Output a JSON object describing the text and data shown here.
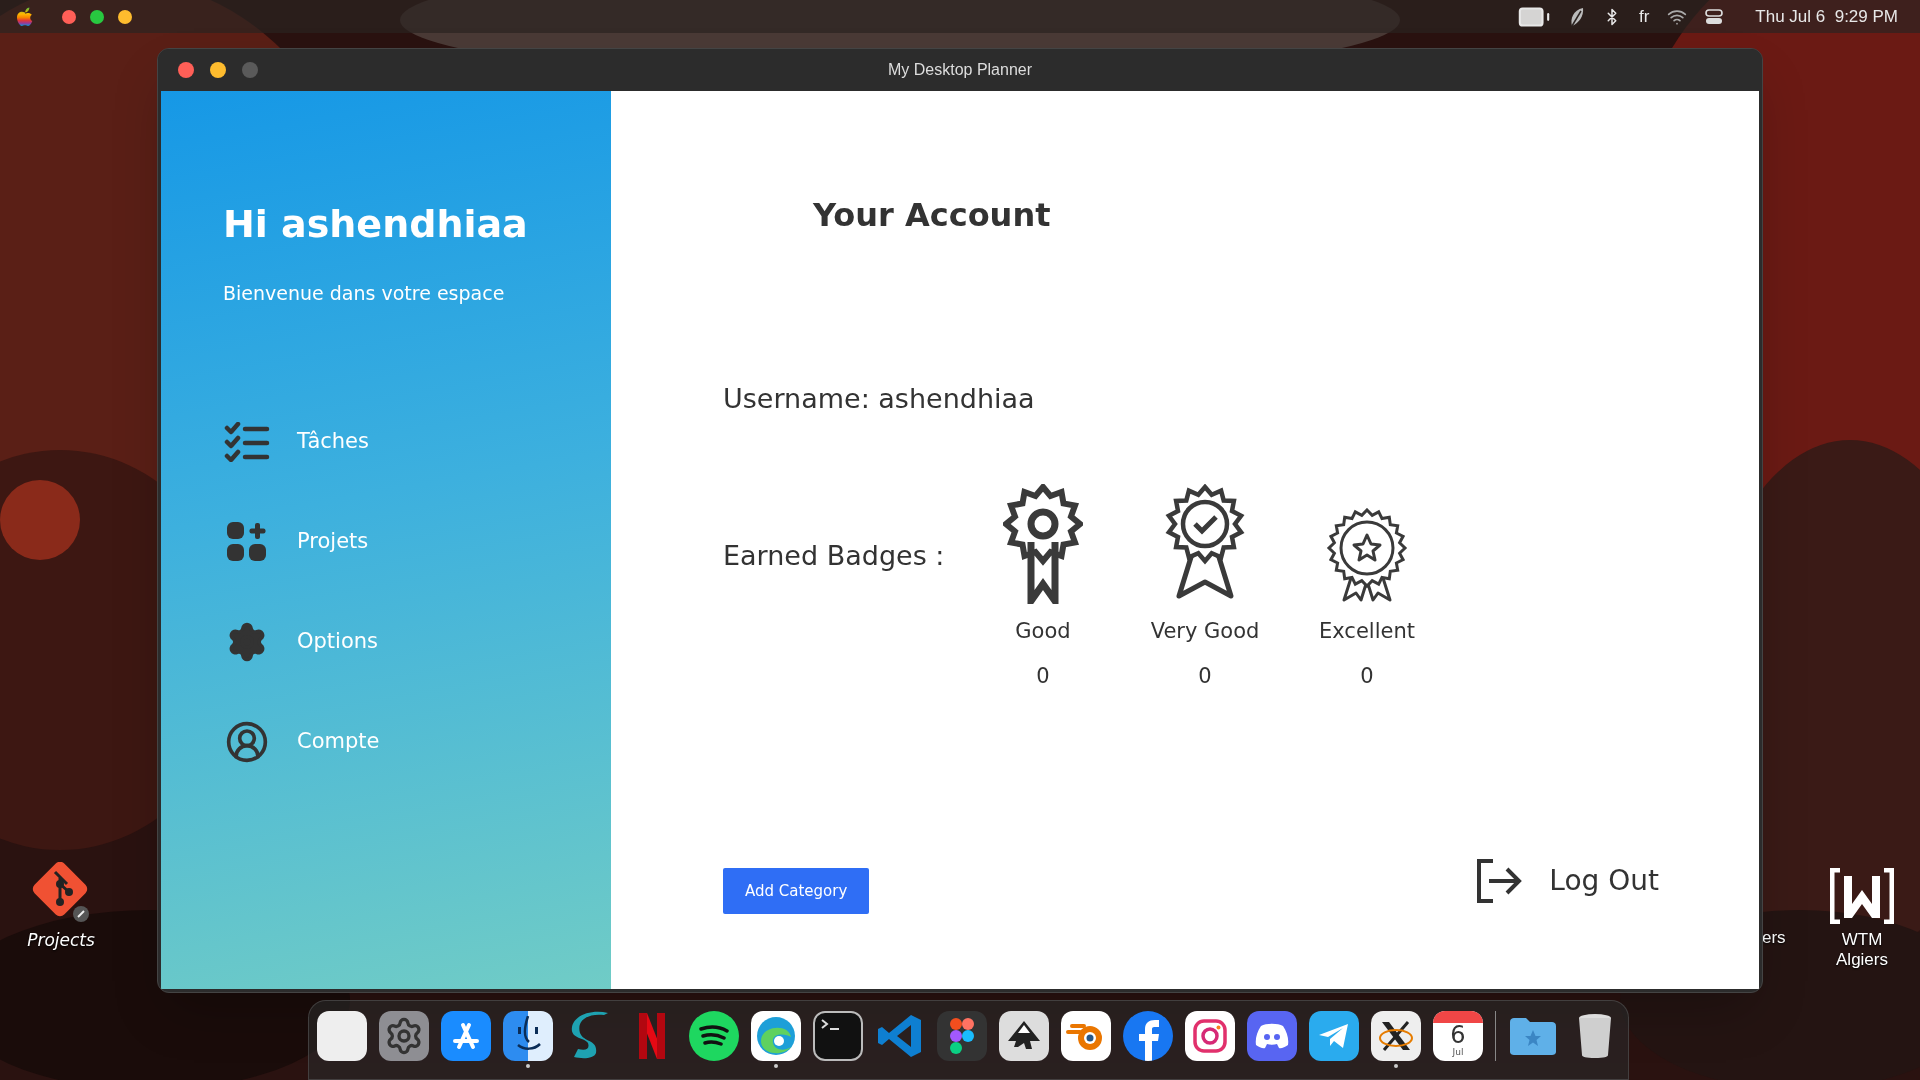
{
  "menu_bar": {
    "language": "fr",
    "clock": "Thu Jul 6  9:29 PM"
  },
  "desktop_icons": [
    {
      "kind": "git",
      "label": "Projects"
    },
    {
      "kind": "hidden",
      "label": "ers"
    },
    {
      "kind": "wtm",
      "label": "WTM Algiers"
    }
  ],
  "window": {
    "title": "My Desktop Planner",
    "sidebar": {
      "greeting": "Hi ashendhiaa",
      "subtitle": "Bienvenue dans votre espace",
      "items": [
        {
          "kind": "tasks",
          "label": "Tâches"
        },
        {
          "kind": "projects",
          "label": "Projets"
        },
        {
          "kind": "options",
          "label": "Options"
        },
        {
          "kind": "account",
          "label": "Compte"
        }
      ]
    },
    "content": {
      "heading": "Your Account",
      "username": "Username: ashendhiaa",
      "badges_label": "Earned Badges :",
      "badges": [
        {
          "kind": "rosette",
          "label": "Good",
          "count": "0"
        },
        {
          "kind": "check",
          "label": "Very Good",
          "count": "0"
        },
        {
          "kind": "star",
          "label": "Excellent",
          "count": "0"
        }
      ],
      "add_button": "Add Category",
      "logout": "Log Out"
    }
  },
  "dock": [
    {
      "kind": "launchpad",
      "running": false
    },
    {
      "kind": "settings",
      "running": false
    },
    {
      "kind": "appstore",
      "running": false
    },
    {
      "kind": "finder",
      "running": true
    },
    {
      "kind": "surf",
      "running": false
    },
    {
      "kind": "netflix",
      "running": false
    },
    {
      "kind": "spotify",
      "running": false
    },
    {
      "kind": "edge",
      "running": true
    },
    {
      "kind": "terminal",
      "running": false
    },
    {
      "kind": "vscode",
      "running": false
    },
    {
      "kind": "figma",
      "running": false
    },
    {
      "kind": "inkscape",
      "running": false
    },
    {
      "kind": "blender",
      "running": false
    },
    {
      "kind": "facebook",
      "running": false
    },
    {
      "kind": "instagram",
      "running": false
    },
    {
      "kind": "discord",
      "running": false
    },
    {
      "kind": "telegram",
      "running": false
    },
    {
      "kind": "xquartz",
      "running": true
    },
    {
      "kind": "calendar",
      "running": false,
      "month": "Jul",
      "day": "6"
    },
    {
      "kind": "separator"
    },
    {
      "kind": "folder",
      "running": false
    },
    {
      "kind": "trash",
      "running": false
    }
  ]
}
